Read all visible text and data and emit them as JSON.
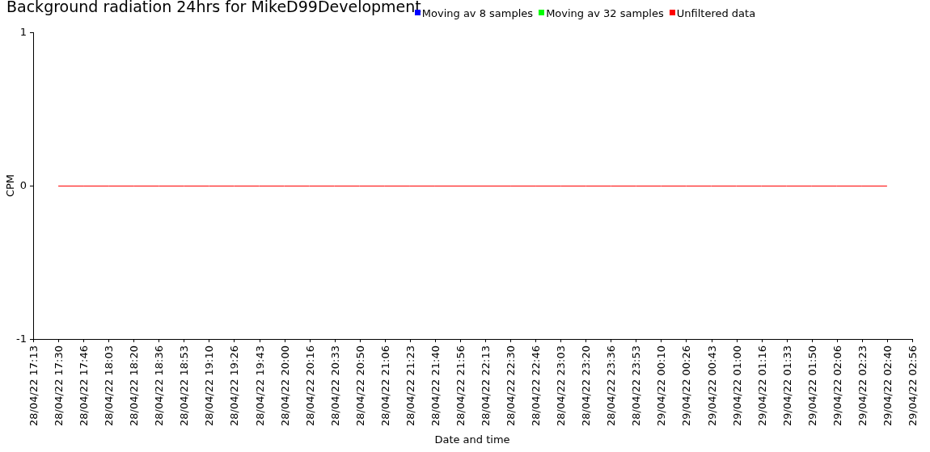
{
  "chart_data": {
    "type": "line",
    "title": "Background radiation 24hrs for MikeD99Development",
    "xlabel": "Date and time",
    "ylabel": "CPM",
    "ylim": [
      -1,
      1
    ],
    "yticks": [
      -1,
      0,
      1
    ],
    "categories": [
      "28/04/22 17:13",
      "28/04/22 17:30",
      "28/04/22 17:46",
      "28/04/22 18:03",
      "28/04/22 18:20",
      "28/04/22 18:36",
      "28/04/22 18:53",
      "28/04/22 19:10",
      "28/04/22 19:26",
      "28/04/22 19:43",
      "28/04/22 20:00",
      "28/04/22 20:16",
      "28/04/22 20:33",
      "28/04/22 20:50",
      "28/04/22 21:06",
      "28/04/22 21:23",
      "28/04/22 21:40",
      "28/04/22 21:56",
      "28/04/22 22:13",
      "28/04/22 22:30",
      "28/04/22 22:46",
      "28/04/22 23:03",
      "28/04/22 23:20",
      "28/04/22 23:36",
      "28/04/22 23:53",
      "29/04/22 00:10",
      "29/04/22 00:26",
      "29/04/22 00:43",
      "29/04/22 01:00",
      "29/04/22 01:16",
      "29/04/22 01:33",
      "29/04/22 01:50",
      "29/04/22 02:06",
      "29/04/22 02:23",
      "29/04/22 02:40",
      "29/04/22 02:56"
    ],
    "series": [
      {
        "name": "Moving av 8 samples",
        "color": "#0000ff",
        "values": [
          null,
          null,
          null,
          null,
          null,
          null,
          null,
          null,
          null,
          null,
          null,
          null,
          null,
          null,
          null,
          null,
          null,
          null,
          null,
          null,
          null,
          null,
          null,
          null,
          null,
          null,
          null,
          null,
          null,
          null,
          null,
          null,
          null,
          null,
          null,
          null
        ]
      },
      {
        "name": "Moving av 32 samples",
        "color": "#00ff00",
        "values": [
          null,
          null,
          null,
          null,
          null,
          null,
          null,
          null,
          null,
          null,
          null,
          null,
          null,
          null,
          null,
          null,
          null,
          null,
          null,
          null,
          null,
          null,
          null,
          null,
          null,
          null,
          null,
          null,
          null,
          null,
          null,
          null,
          null,
          null,
          null,
          null
        ]
      },
      {
        "name": "Unfiltered data",
        "color": "#ff0000",
        "values": [
          null,
          0,
          0,
          0,
          0,
          0,
          0,
          0,
          0,
          0,
          0,
          0,
          0,
          0,
          0,
          0,
          0,
          0,
          0,
          0,
          0,
          0,
          0,
          0,
          0,
          0,
          0,
          0,
          0,
          0,
          0,
          0,
          0,
          0,
          0,
          null
        ]
      }
    ]
  }
}
